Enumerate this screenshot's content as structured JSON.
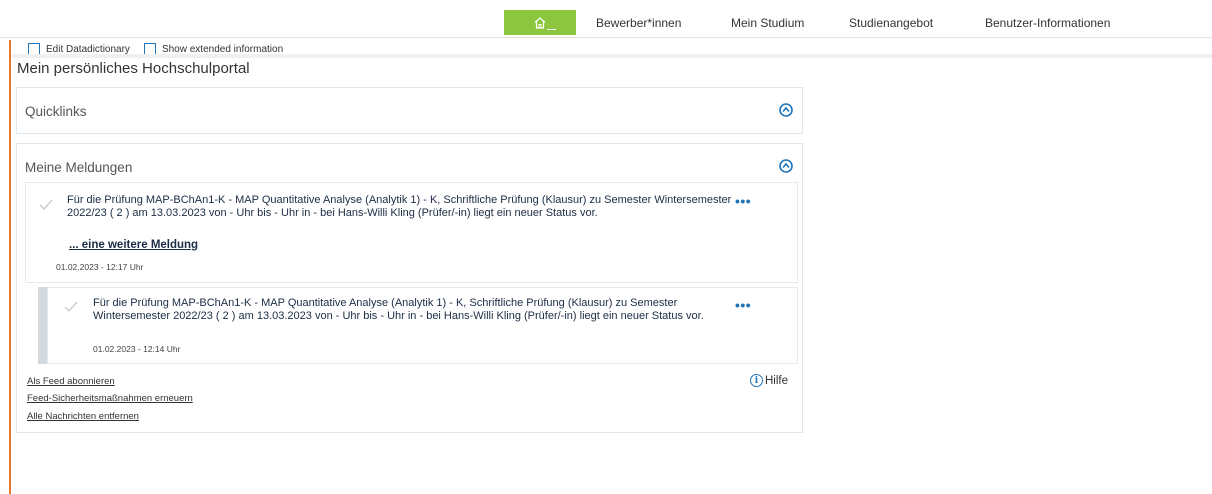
{
  "nav": {
    "items": [
      {
        "label": "Bewerber*innen"
      },
      {
        "label": "Mein Studium"
      },
      {
        "label": "Studienangebot"
      },
      {
        "label": "Benutzer-Informationen"
      }
    ],
    "home_icon": "home-icon",
    "accent_color": "#8cc63f"
  },
  "edit_bar": {
    "edit_datadictionary": "Edit Datadictionary",
    "show_extended": "Show extended information"
  },
  "page_title": "Mein persönliches Hochschulportal",
  "quicklinks": {
    "title": "Quicklinks"
  },
  "meldungen": {
    "title": "Meine Meldungen",
    "messages": [
      {
        "text": "Für die Prüfung MAP-BChAn1-K - MAP Quantitative Analyse (Analytik 1) - K, Schriftliche Prüfung (Klausur) zu Semester Wintersemester 2022/23 ( 2 ) am 13.03.2023 von - Uhr bis - Uhr in - bei Hans-Willi Kling (Prüfer/-in) liegt ein neuer Status vor.",
        "more_link": "... eine weitere Meldung",
        "time": "01.02.2023 - 12:17 Uhr"
      },
      {
        "text": "Für die Prüfung MAP-BChAn1-K - MAP Quantitative Analyse (Analytik 1) - K, Schriftliche Prüfung (Klausur) zu Semester Wintersemester 2022/23 ( 2 ) am 13.03.2023 von - Uhr bis - Uhr in - bei Hans-Willi Kling (Prüfer/-in) liegt ein neuer Status vor.",
        "time": "01.02.2023 - 12:14 Uhr"
      }
    ],
    "more_button": "•••",
    "footer": {
      "feed": "Als Feed abonnieren",
      "security": "Feed-Sicherheitsmaßnahmen erneuern",
      "remove": "Alle Nachrichten entfernen",
      "help": "Hilfe"
    }
  },
  "colors": {
    "brand_blue": "#1f74b8",
    "left_accent": "#e6792a"
  }
}
